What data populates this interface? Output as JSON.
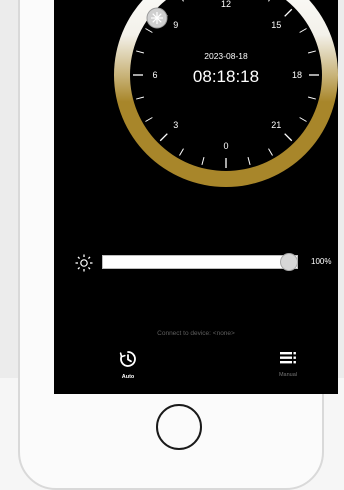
{
  "dial": {
    "date": "2023-08-18",
    "time": "08:18:18",
    "hour_labels": [
      "0",
      "3",
      "6",
      "9",
      "12",
      "15",
      "18",
      "21"
    ],
    "colors": {
      "face": "#000000",
      "ring_light": "#ffffff",
      "ring_gold": "#a8862a"
    },
    "marker_icon": "sun-marker-icon"
  },
  "brightness": {
    "icon": "sun-icon",
    "level": 1.0,
    "percent_label": "100%"
  },
  "status": {
    "text": "Connect to device: <none>"
  },
  "nav": {
    "auto_label": "Auto",
    "auto_icon": "clock-icon",
    "manual_label": "Manual",
    "manual_icon": "list-icon"
  }
}
